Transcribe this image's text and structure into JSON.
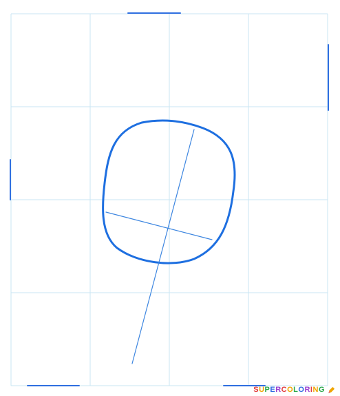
{
  "watermark": {
    "text": "SUPERCOLORING",
    "icon": "pencil-icon"
  },
  "colors": {
    "grid": "#c9e6f3",
    "head_outline": "#1e6fe0",
    "guides": "#3d86e0",
    "edge_marks": "#2f6fe0"
  }
}
